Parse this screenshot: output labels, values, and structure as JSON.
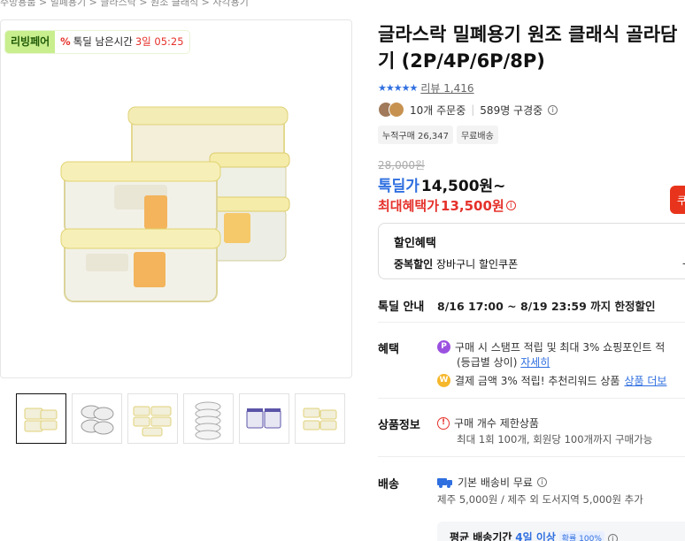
{
  "breadcrumb": "주방용품 > 밀폐용기 > 글라스락 > 원조 클래식 > 사각용기",
  "badge": {
    "left": "리빙페어",
    "pct": "%",
    "remain_label": "톡딜 남은시간",
    "remain_time": "3일 05:25"
  },
  "product": {
    "title": "글라스락 밀폐용기 원조 클래식 골라담기 (2P/4P/6P/8P)",
    "stars": "★★★★★",
    "review_link": "리뷰 1,416",
    "orders_now": "10개 주문중",
    "watching": "589명 구경중",
    "chips": [
      "누적구매 26,347",
      "무료배송"
    ],
    "original_price": "28,000원",
    "sale_label": "톡딜가",
    "sale_price": "14,500원~",
    "max_label": "최대혜택가",
    "max_price": "13,500원",
    "coupon_char": "쿠"
  },
  "discount": {
    "title": "할인혜택",
    "row_label": "중복할인",
    "row_text": "장바구니 할인쿠폰",
    "arrow": "-"
  },
  "timed": {
    "label": "톡딜 안내",
    "text": "8/16 17:00 ~ 8/19 23:59 까지 한정할인"
  },
  "benefit": {
    "label": "혜택",
    "line1": "구매 시 스탬프 적립 및 최대 3% 쇼핑포인트 적",
    "line1_sub": "(등급별 상이)",
    "line1_link": "자세히",
    "line2": "결제 금액 3% 적립! 추천리워드 상품",
    "line2_link": "상품 더보"
  },
  "product_info": {
    "label": "상품정보",
    "line1": "구매 개수 제한상품",
    "line2": "최대 1회 100개, 회원당 100개까지 구매가능"
  },
  "shipping": {
    "label": "배송",
    "line1": "기본 배송비 무료",
    "line2": "제주 5,000원 / 제주 외 도서지역 5,000원 추가",
    "period_label": "평균 배송기간",
    "period_value": "4일 이상",
    "period_pct": "확률 100%"
  },
  "thumbnails": [
    "thumb-1",
    "thumb-2",
    "thumb-3",
    "thumb-4",
    "thumb-5",
    "thumb-6"
  ],
  "colors": {
    "accent_blue": "#2f6fe0",
    "accent_red": "#e5312b",
    "badge_green": "#c8ee8e"
  }
}
